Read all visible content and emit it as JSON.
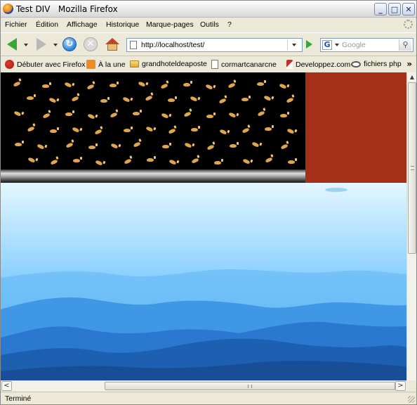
{
  "window": {
    "title": "Test DIV   Mozilla Firefox",
    "minimize_glyph": "_",
    "maximize_glyph": "□",
    "close_glyph": "✕"
  },
  "menu": {
    "items": [
      "Fichier",
      "Édition",
      "Affichage",
      "Historique",
      "Marque-pages",
      "Outils",
      "?"
    ]
  },
  "navigation": {
    "url": "http://localhost/test/",
    "search_placeholder": "Google",
    "search_engine_glyph": "G",
    "reload_glyph": "↻",
    "stop_glyph": "✕",
    "search_go_glyph": "⚲"
  },
  "bookmarks": {
    "items": [
      {
        "label": "Débuter avec Firefox",
        "icon": "firefox-icon"
      },
      {
        "label": "À la une",
        "icon": "rss-icon"
      },
      {
        "label": "grandhoteldeaposte",
        "icon": "folder-icon"
      },
      {
        "label": "cormartcanarcne",
        "icon": "page-icon"
      },
      {
        "label": "Developpez.com",
        "icon": "developpez-icon"
      },
      {
        "label": "fichiers php",
        "icon": "eye-icon"
      }
    ],
    "more_glyph": "»"
  },
  "scrollbars": {
    "vertical_up": "▲",
    "left": "<",
    "right": ">"
  },
  "status": {
    "text": "Terminé"
  },
  "colors": {
    "red_block": "#a53019",
    "black_block": "#000000",
    "sky_top": "#ddf4ff",
    "mountain_dark": "#1d5fb0"
  }
}
